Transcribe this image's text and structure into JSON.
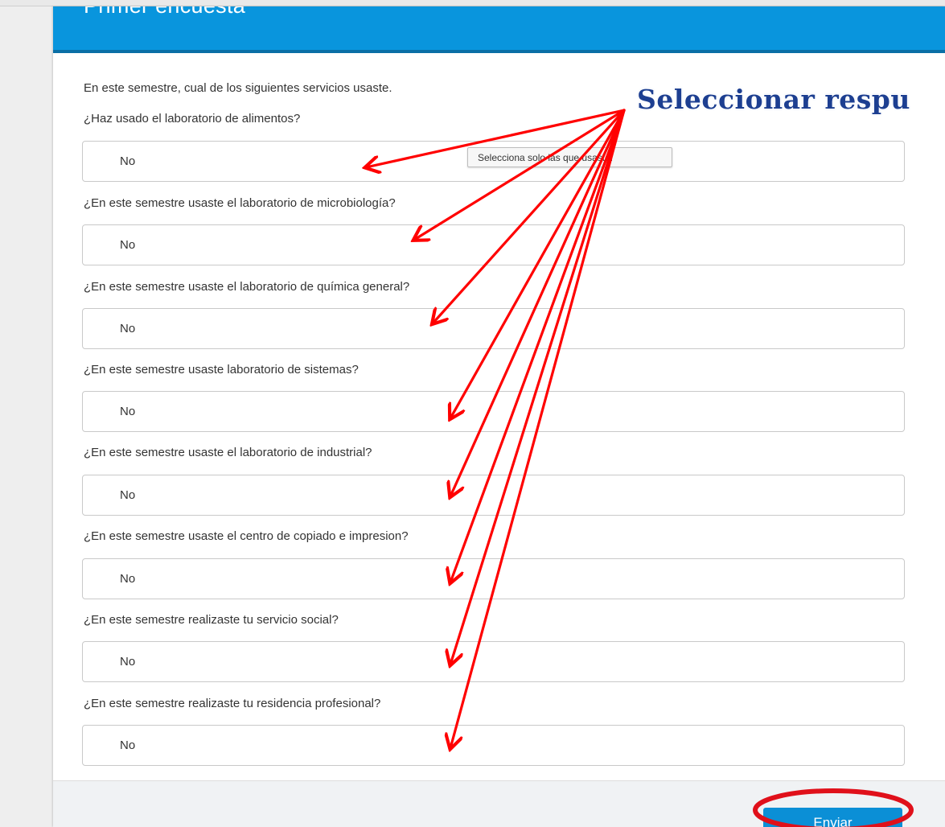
{
  "survey": {
    "title": "Primer encuesta",
    "intro": "En este semestre, cual de los siguientes servicios usaste.",
    "tooltip": "Selecciona solo las que usaste.",
    "questions": [
      {
        "label": "¿Haz usado el laboratorio de alimentos?",
        "answer": "No"
      },
      {
        "label": "¿En este semestre usaste el laboratorio de microbiología?",
        "answer": "No"
      },
      {
        "label": "¿En este semestre usaste el laboratorio de química general?",
        "answer": "No"
      },
      {
        "label": "¿En este semestre usaste laboratorio de sistemas?",
        "answer": "No"
      },
      {
        "label": "¿En este semestre usaste el laboratorio de industrial?",
        "answer": "No"
      },
      {
        "label": "¿En este semestre usaste el centro de copiado e impresion?",
        "answer": "No"
      },
      {
        "label": "¿En este semestre realizaste tu servicio social?",
        "answer": "No"
      },
      {
        "label": "¿En este semestre realizaste tu residencia profesional?",
        "answer": "No"
      }
    ],
    "submit_label": "Enviar"
  },
  "annotation": {
    "text": "Seleccionar respu",
    "arrow_color": "#ff0000",
    "text_color": "#1d3f91"
  },
  "colors": {
    "header": "#0995dd",
    "button": "#0b8fd6"
  }
}
